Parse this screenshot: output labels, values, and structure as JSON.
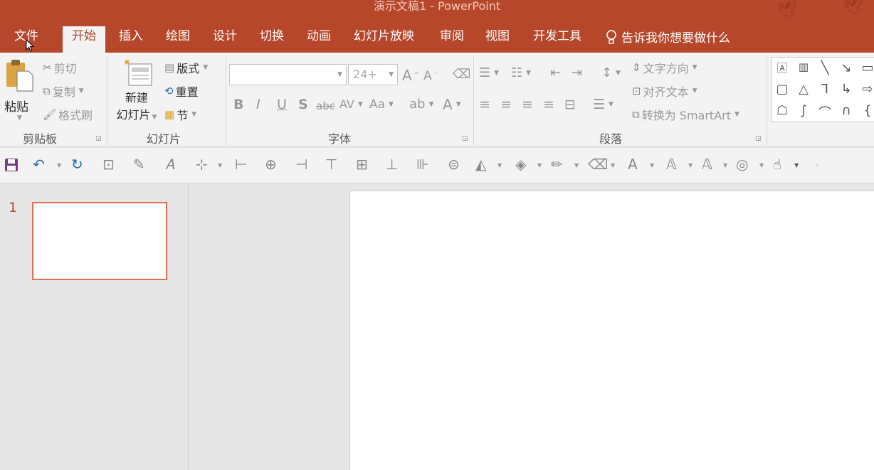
{
  "window": {
    "title": "演示文稿1  -  PowerPoint"
  },
  "tabs": [
    "文件",
    "开始",
    "插入",
    "绘图",
    "设计",
    "切换",
    "动画",
    "幻灯片放映",
    "审阅",
    "视图",
    "开发工具"
  ],
  "active_tab": "开始",
  "tell_me": "告诉我你想要做什么",
  "clipboard": {
    "paste": "粘贴",
    "cut": "剪切",
    "copy": "复制",
    "format_painter": "格式刷",
    "group_label": "剪贴板"
  },
  "slides": {
    "new_slide_1": "新建",
    "new_slide_2": "幻灯片",
    "layout": "版式",
    "reset": "重置",
    "section": "节",
    "group_label": "幻灯片"
  },
  "font": {
    "size": "24+",
    "bold": "B",
    "italic": "I",
    "underline": "U",
    "shadow": "S",
    "strike": "abc",
    "spacing": "AV",
    "case": "Aa",
    "grow": "A",
    "shrink": "A",
    "color": "A",
    "group_label": "字体"
  },
  "paragraph": {
    "text_direction": "文字方向",
    "align_text": "对齐文本",
    "smartart": "转换为 SmartArt",
    "group_label": "段落"
  },
  "thumbnail": {
    "number": "1"
  },
  "colors": {
    "accent": "#b7472a",
    "ribbon_bg": "#f3f3f3",
    "thumb_border": "#e07050"
  }
}
